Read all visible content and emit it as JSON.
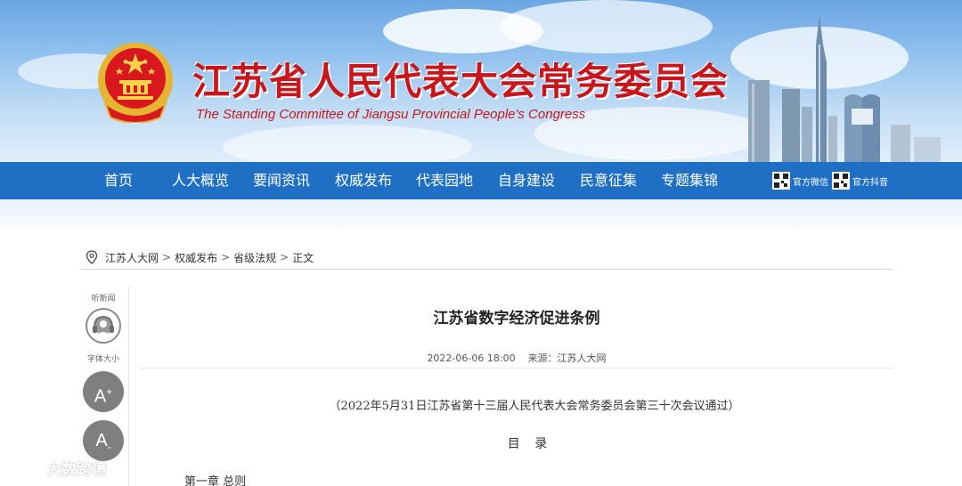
{
  "header": {
    "title_cn": "江苏省人民代表大会常务委员会",
    "title_en": "The Standing Committee of Jiangsu Provincial People's Congress",
    "brand_red": "#c8161d"
  },
  "nav": {
    "background": "#1f6fc4",
    "items": [
      {
        "label": "首页"
      },
      {
        "label": "人大概览"
      },
      {
        "label": "要闻资讯"
      },
      {
        "label": "权威发布"
      },
      {
        "label": "代表园地"
      },
      {
        "label": "自身建设"
      },
      {
        "label": "民意征集"
      },
      {
        "label": "专题集锦"
      }
    ],
    "social": [
      {
        "label": "官方微信",
        "icon": "qr-code-icon"
      },
      {
        "label": "官方抖音",
        "icon": "qr-code-icon"
      }
    ]
  },
  "breadcrumb": {
    "icon": "location-pin-icon",
    "items": [
      "江苏人大网",
      "权威发布",
      "省级法规",
      "正文"
    ],
    "separator": ">"
  },
  "tools": {
    "listen_label": "听新闻",
    "font_size_label": "字体大小",
    "font_increase": "A",
    "font_increase_mark": "+",
    "font_decrease": "A",
    "font_decrease_mark": "-"
  },
  "article": {
    "title": "江苏省数字经济促进条例",
    "date": "2022-06-06 18:00",
    "source": "来源：江苏人大网",
    "adopted_note": "（2022年5月31日江苏省第十三届人民代表大会常务委员会第三十次会议通过）",
    "toc_title": "目 录",
    "chapter_1": "第一章  总则"
  },
  "watermark": {
    "text": "大数跨境"
  }
}
